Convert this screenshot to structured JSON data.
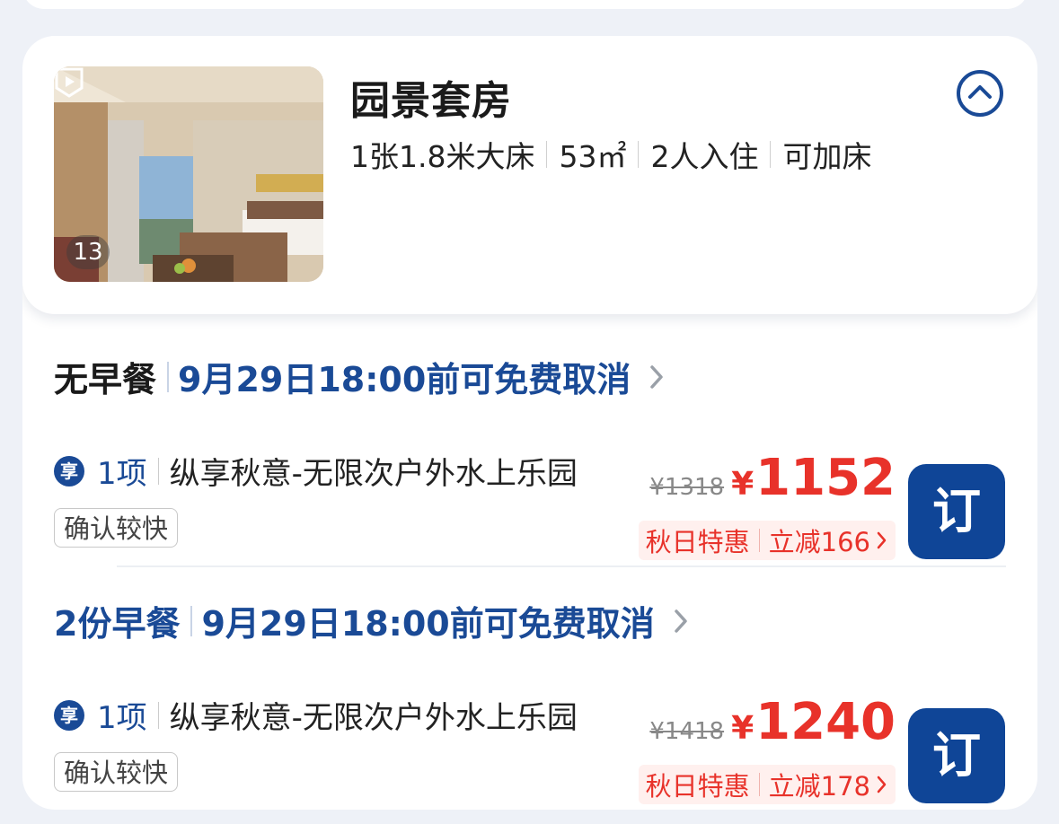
{
  "room": {
    "title": "园景套房",
    "specs": [
      "1张1.8米大床",
      "53㎡",
      "2人入住",
      "可加床"
    ],
    "photo_count": "13"
  },
  "icons": {
    "collapse": "chevron-up-circle-icon",
    "video": "video-play-icon",
    "detail_chevron": "chevron-right-icon",
    "perk": "xiang-badge-icon"
  },
  "colors": {
    "brand_blue": "#0f4597",
    "price_red": "#e8322a",
    "promo_bg": "#fff0ee"
  },
  "rates": [
    {
      "meal": "无早餐",
      "cancel": "9月29日18:00前可免费取消",
      "perk_badge": "享",
      "perk_count": "1项",
      "perk_text": "纵享秋意-无限次户外水上乐园",
      "confirm": "确认较快",
      "original_price": "¥1318",
      "currency": "¥",
      "price": "1152",
      "promo_name": "秋日特惠",
      "promo_discount": "立减166",
      "book_label": "订"
    },
    {
      "meal": "2份早餐",
      "cancel": "9月29日18:00前可免费取消",
      "perk_badge": "享",
      "perk_count": "1项",
      "perk_text": "纵享秋意-无限次户外水上乐园",
      "confirm": "确认较快",
      "original_price": "¥1418",
      "currency": "¥",
      "price": "1240",
      "promo_name": "秋日特惠",
      "promo_discount": "立减178",
      "book_label": "订"
    }
  ]
}
